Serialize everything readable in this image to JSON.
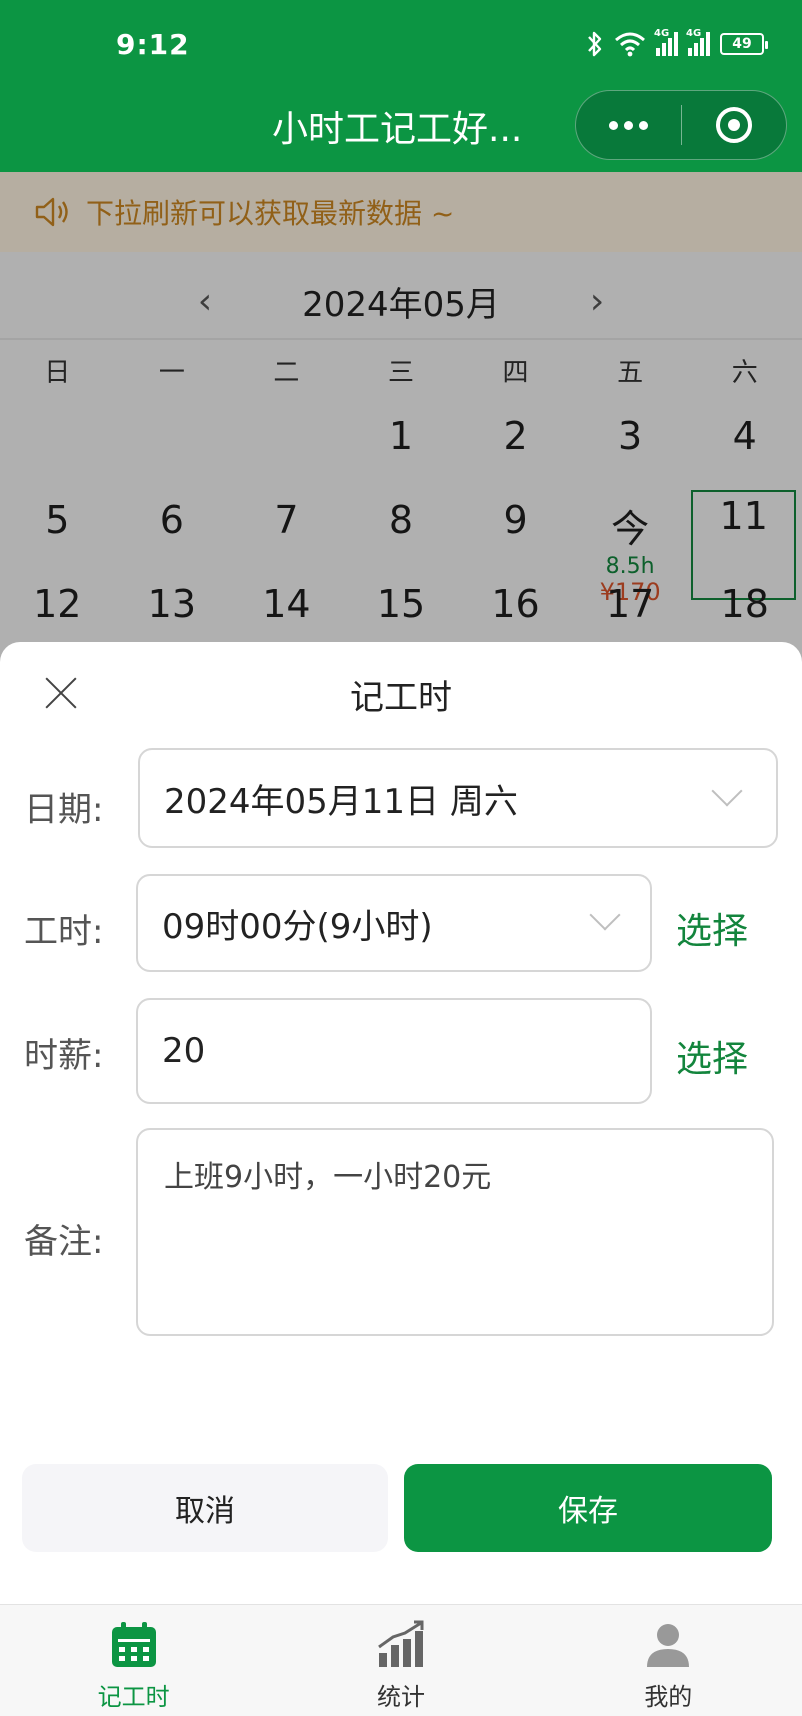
{
  "status_bar": {
    "time": "9:12",
    "net_1": "4G",
    "net_2": "4G",
    "battery": "49"
  },
  "nav": {
    "title": "小时工记工好..."
  },
  "notice": {
    "text": "下拉刷新可以获取最新数据 ~",
    "icon": "speaker-icon"
  },
  "calendar": {
    "month_label": "2024年05月",
    "weekdays": [
      "日",
      "一",
      "二",
      "三",
      "四",
      "五",
      "六"
    ],
    "week1": [
      "",
      "",
      "",
      "1",
      "2",
      "3",
      "4"
    ],
    "week2": [
      "5",
      "6",
      "7",
      "8",
      "9",
      "今",
      "11"
    ],
    "today_hours": "8.5h",
    "today_pay": "¥170",
    "week3": [
      "12",
      "13",
      "14",
      "15",
      "16",
      "17",
      "18"
    ]
  },
  "sheet": {
    "title": "记工时",
    "date_label": "日期:",
    "date_value": "2024年05月11日 周六",
    "hours_label": "工时:",
    "hours_value": "09时00分(9小时)",
    "hours_pick": "选择",
    "wage_label": "时薪:",
    "wage_value": "20",
    "wage_pick": "选择",
    "note_label": "备注:",
    "note_value": "上班9小时，一小时20元",
    "cancel": "取消",
    "save": "保存"
  },
  "tabs": {
    "record": "记工时",
    "stats": "统计",
    "mine": "我的"
  },
  "colors": {
    "brand": "#0c9543",
    "notice_text": "#c98622",
    "pay": "#d9542b"
  }
}
